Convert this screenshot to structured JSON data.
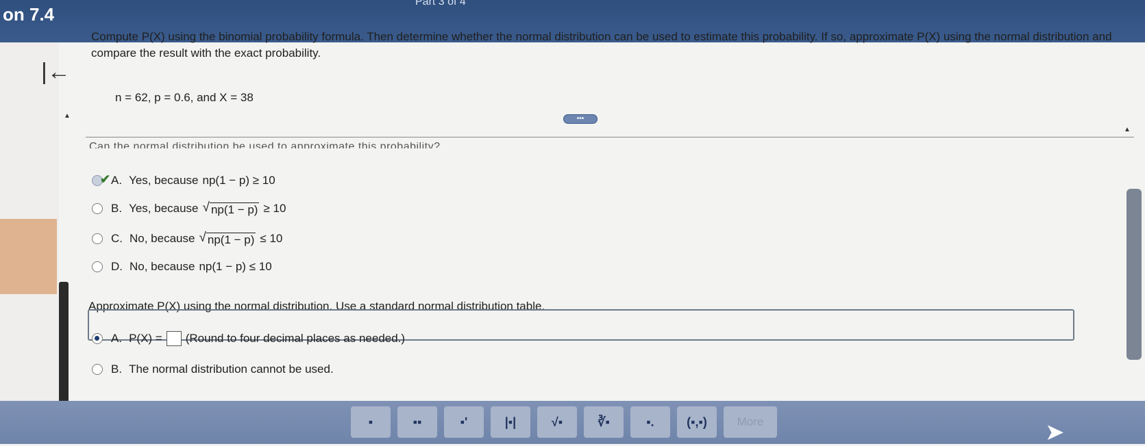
{
  "header": {
    "section_title": "on 7.4",
    "part_label": "Part 3 of 4"
  },
  "question": {
    "text": "Compute P(X) using the binomial probability formula. Then determine whether the normal distribution can be used to estimate this probability. If so, approximate P(X) using the normal distribution and compare the result with the exact probability.",
    "given": "n = 62, p = 0.6, and X = 38"
  },
  "divider_handle": "•••",
  "part1": {
    "cutoff_prompt": "Can the normal distribution be used to approximate this probability?",
    "options": [
      {
        "letter": "A.",
        "prefix": "Yes, because",
        "expr": "np(1 − p) ≥ 10"
      },
      {
        "letter": "B.",
        "prefix": "Yes, because",
        "sqrt": "np(1 − p)",
        "suffix": "≥ 10"
      },
      {
        "letter": "C.",
        "prefix": "No, because",
        "sqrt": "np(1 − p)",
        "suffix": "≤ 10"
      },
      {
        "letter": "D.",
        "prefix": "No, because",
        "expr": "np(1 − p) ≤ 10"
      }
    ]
  },
  "part2": {
    "prompt": "Approximate P(X) using the normal distribution. Use a standard normal distribution table.",
    "option_a": {
      "letter": "A.",
      "lhs": "P(X) =",
      "note": "(Round to four decimal places as needed.)"
    },
    "option_b": {
      "letter": "B.",
      "text": "The normal distribution cannot be used."
    }
  },
  "toolbar": {
    "tools": [
      "▪",
      "▪▪",
      "▪'",
      "|▪|",
      "√▪",
      "∛▪",
      "▪.",
      "(▪,▪)"
    ],
    "more": "More"
  }
}
